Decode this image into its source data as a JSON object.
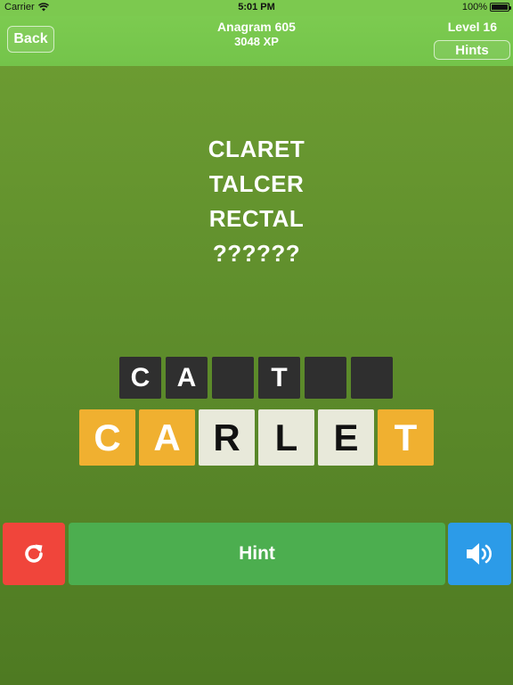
{
  "status_bar": {
    "carrier": "Carrier",
    "time": "5:01 PM",
    "battery": "100%"
  },
  "header": {
    "back_label": "Back",
    "title": "Anagram 605",
    "xp": "3048 XP",
    "level": "Level 16",
    "hints_label": "Hints"
  },
  "clues": [
    "CLARET",
    "TALCER",
    "RECTAL",
    "??????"
  ],
  "answer_slots": [
    "C",
    "A",
    "",
    "T",
    "",
    ""
  ],
  "tiles": [
    {
      "letter": "C",
      "state": "used"
    },
    {
      "letter": "A",
      "state": "used"
    },
    {
      "letter": "R",
      "state": "free"
    },
    {
      "letter": "L",
      "state": "free"
    },
    {
      "letter": "E",
      "state": "free"
    },
    {
      "letter": "T",
      "state": "used"
    }
  ],
  "controls": {
    "hint_label": "Hint",
    "reset_icon": "refresh-icon",
    "sound_icon": "speaker-icon"
  },
  "colors": {
    "reset": "#f0453b",
    "hint": "#4cae4f",
    "sound": "#2c9be8",
    "tile_used": "#f0b030",
    "tile_free": "#e8e9da",
    "slot": "#2f2f2f"
  }
}
